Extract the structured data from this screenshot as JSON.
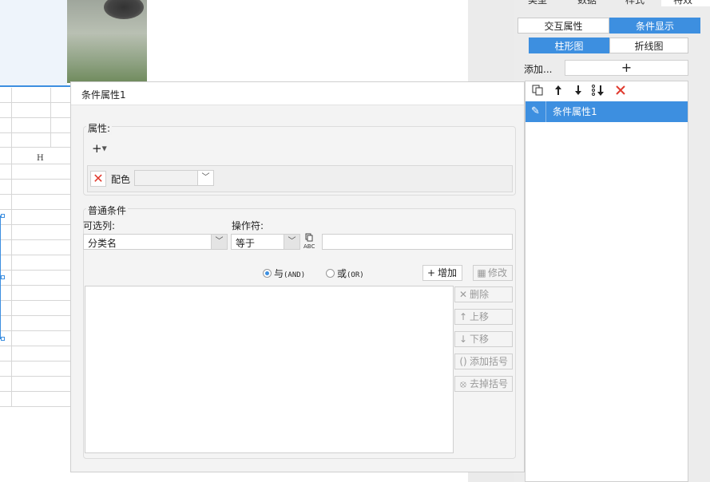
{
  "right_panel": {
    "top_tabs": [
      "类型",
      "数据",
      "样式",
      "特效"
    ],
    "mode_tabs": [
      "交互属性",
      "条件显示"
    ],
    "chart_tabs": [
      "柱形图",
      "折线图"
    ],
    "add_label": "添加...",
    "add_button": "+",
    "toolbar_icons": [
      "copy-icon",
      "move-up-icon",
      "move-down-icon",
      "move-bottom-icon",
      "delete-icon"
    ],
    "condition_items": [
      "条件属性1"
    ]
  },
  "spreadsheet": {
    "visible_column": "H"
  },
  "dialog": {
    "title": "条件属性1",
    "property_group": {
      "label": "属性:",
      "add_button": "+",
      "item": {
        "label": "配色",
        "value": ""
      }
    },
    "condition_group": {
      "label": "普通条件",
      "column_label": "可选列:",
      "column_value": "分类名",
      "operator_label": "操作符:",
      "operator_value": "等于",
      "value": "",
      "abc_icon_text": "ABC",
      "radio_and": "与",
      "radio_and_code": "(AND)",
      "radio_or": "或",
      "radio_or_code": "(OR)",
      "selected": "AND",
      "buttons": {
        "add": "增加",
        "modify": "修改",
        "delete": "删除",
        "move_up": "上移",
        "move_down": "下移",
        "add_bracket": "添加括号",
        "remove_bracket": "去掉括号"
      }
    }
  },
  "colors": {
    "accent": "#3d8fe0",
    "delete_red": "#e03a2e"
  }
}
